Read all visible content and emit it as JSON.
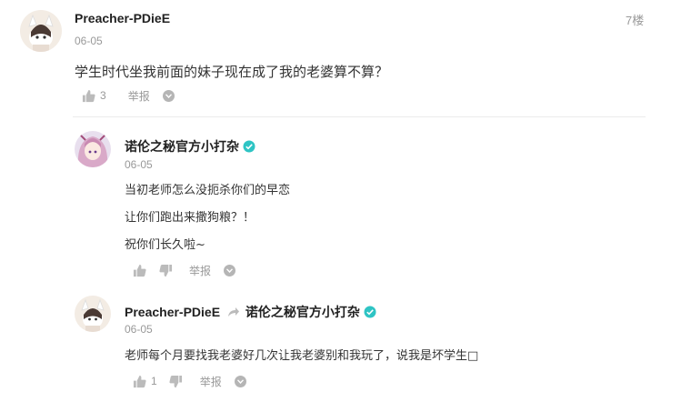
{
  "comment": {
    "username": "Preacher-PDieE",
    "date": "06-05",
    "floor": "7楼",
    "text": "学生时代坐我前面的妹子现在成了我的老婆算不算？",
    "like_count": "3",
    "report_label": "举报"
  },
  "replies": [
    {
      "username": "诺伦之秘官方小打杂",
      "verified": true,
      "date": "06-05",
      "lines": [
        "当初老师怎么没扼杀你们的早恋",
        "让你们跑出来撒狗粮？！",
        "祝你们长久啦~"
      ],
      "like_count": "",
      "report_label": "举报"
    },
    {
      "username": "Preacher-PDieE",
      "reply_to": "诺伦之秘官方小打杂",
      "reply_to_verified": true,
      "date": "06-05",
      "text": "老师每个月要找我老婆好几次让我老婆别和我玩了，说我是坏学生□",
      "like_count": "1",
      "report_label": "举报"
    }
  ],
  "colors": {
    "verified_badge": "#2ec4c4",
    "icon_gray": "#bbbbbb",
    "meta_text": "#999999"
  },
  "icons": [
    "thumbs-up-icon",
    "thumbs-down-icon",
    "chevron-down-circle-icon",
    "verified-badge-icon",
    "reply-arrow-icon"
  ]
}
